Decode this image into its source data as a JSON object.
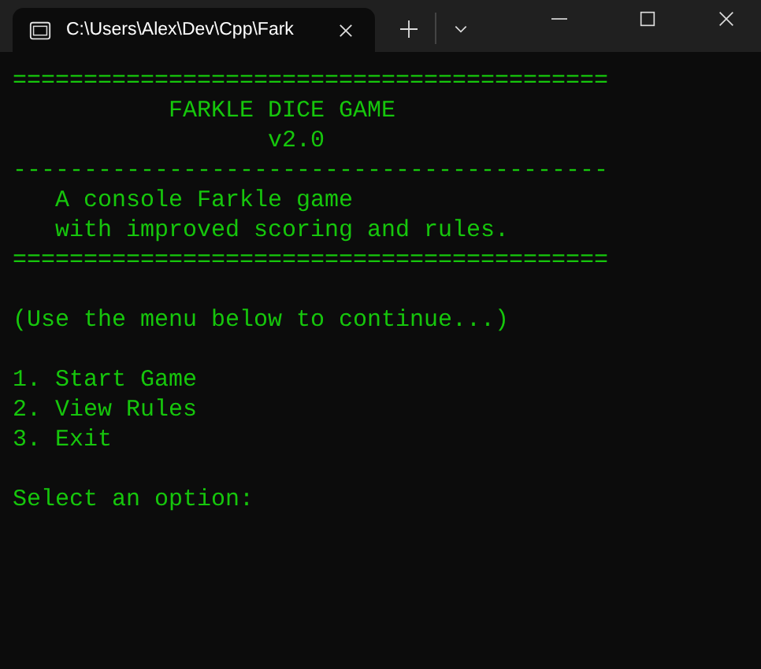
{
  "tab": {
    "title": "C:\\Users\\Alex\\Dev\\Cpp\\Fark",
    "selected": true
  },
  "terminal": {
    "blocks": [
      {
        "lines": [
          "==========================================",
          "           FARKLE DICE GAME",
          "                  v2.0",
          "------------------------------------------",
          "   A console Farkle game",
          "   with improved scoring and rules.",
          "=========================================="
        ]
      },
      {
        "lines": [
          "(Use the menu below to continue...)"
        ]
      },
      {
        "lines": [
          "1. Start Game",
          "2. View Rules",
          "3. Exit"
        ]
      },
      {
        "lines": [
          "Select an option:"
        ]
      }
    ]
  }
}
